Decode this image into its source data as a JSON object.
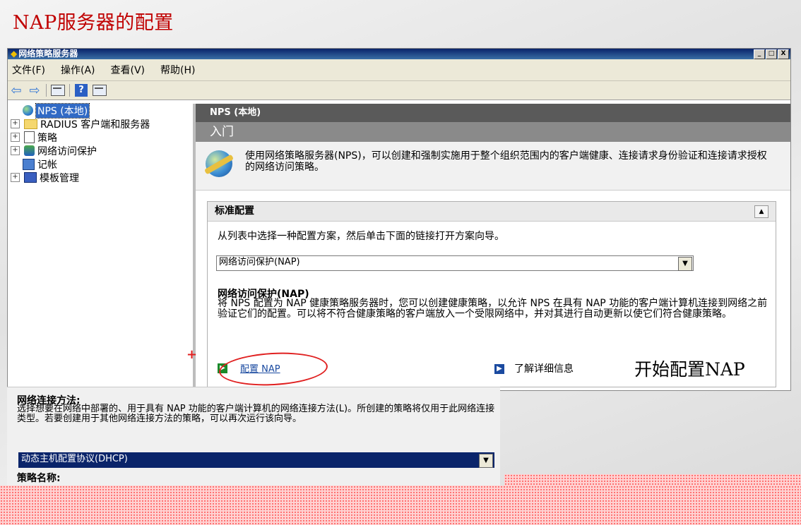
{
  "slide": {
    "title": "NAP服务器的配置"
  },
  "window": {
    "title": "网络策略服务器",
    "controls": [
      "_",
      "□",
      "X"
    ]
  },
  "menu": [
    "文件(F)",
    "操作(A)",
    "查看(V)",
    "帮助(H)"
  ],
  "tree": [
    {
      "label": "NPS (本地)",
      "icon": "globe-icon",
      "expander": false,
      "selected": true
    },
    {
      "label": "RADIUS 客户端和服务器",
      "icon": "folder-icon",
      "expander": true
    },
    {
      "label": "策略",
      "icon": "document-icon",
      "expander": true
    },
    {
      "label": "网络访问保护",
      "icon": "shield-icon",
      "expander": true
    },
    {
      "label": "记帐",
      "icon": "log-icon",
      "expander": false
    },
    {
      "label": "模板管理",
      "icon": "template-icon",
      "expander": true
    }
  ],
  "content": {
    "header": "NPS (本地)",
    "section": "入门",
    "intro": "使用网络策略服务器(NPS)，可以创建和强制实施用于整个组织范围内的客户端健康、连接请求身份验证和连接请求授权的网络访问策略。",
    "panel": {
      "title": "标准配置",
      "desc": "从列表中选择一种配置方案，然后单击下面的链接打开方案向导。",
      "select_value": "网络访问保护(NAP)",
      "nap_title": "网络访问保护(NAP)",
      "nap_desc": "将 NPS 配置为 NAP 健康策略服务器时，您可以创建健康策略，以允许 NPS 在具有 NAP 功能的客户端计算机连接到网络之前验证它们的配置。可以将不符合健康策略的客户端放入一个受限网络中，并对其进行自动更新以使它们符合健康策略。",
      "configure_link": "配置 NAP",
      "learn_more": "了解详细信息",
      "caption": "开始配置NAP"
    }
  },
  "dialog": {
    "label": "网络连接方法:",
    "desc": "选择想要在网络中部署的、用于具有 NAP 功能的客户端计算机的网络连接方法(L)。所创建的策略将仅用于此网络连接类型。若要创建用于其他网络连接方法的策略，可以再次运行该向导。",
    "select_value": "动态主机配置协议(DHCP)",
    "label2": "策略名称:"
  },
  "hint": "选择",
  "colors": {
    "accent_red": "#c00000",
    "selection_blue": "#316ac5",
    "header_gray": "#5a5a5a"
  }
}
